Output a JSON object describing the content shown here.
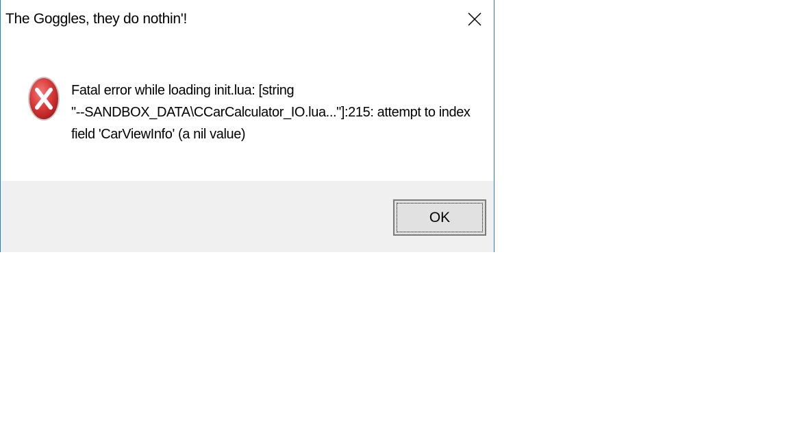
{
  "dialog": {
    "title": "The Goggles, they do nothin'!",
    "close_icon": "close-icon",
    "error_icon": "error-icon",
    "message_lines": [
      "Fatal error while loading init.lua: [string",
      "\"--SANDBOX_DATA\\CCarCalculator_IO.lua...\"]:215: attempt to index",
      "field 'CarViewInfo' (a nil value)"
    ],
    "ok_label": "OK"
  },
  "colors": {
    "window_border": "#1883d7",
    "footer_background": "#f0f0f0",
    "button_background": "#e1e1e1",
    "error_red": "#d32f2f"
  }
}
